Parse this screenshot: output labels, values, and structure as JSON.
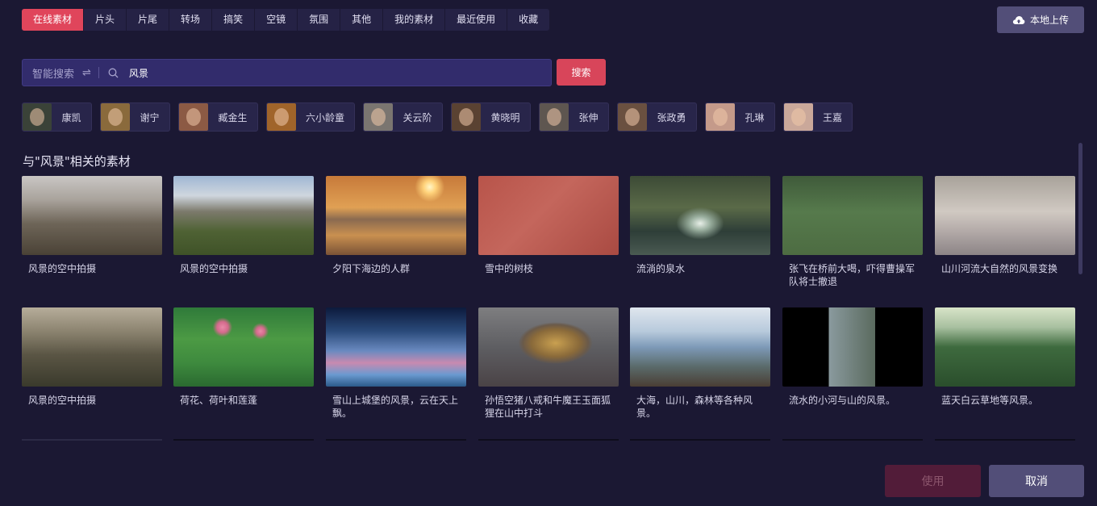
{
  "tabs": [
    "在线素材",
    "片头",
    "片尾",
    "转场",
    "搞笑",
    "空镜",
    "氛围",
    "其他",
    "我的素材",
    "最近使用",
    "收藏"
  ],
  "active_tab": "在线素材",
  "upload_label": "本地上传",
  "search": {
    "mode_label": "智能搜索",
    "swap_symbol": "⇌",
    "query": "风景",
    "button_label": "搜索"
  },
  "people": [
    {
      "name": "康凯",
      "icon": "face-portrait"
    },
    {
      "name": "谢宁",
      "icon": "face-portrait"
    },
    {
      "name": "臧金生",
      "icon": "face-portrait"
    },
    {
      "name": "六小龄童",
      "icon": "face-portrait"
    },
    {
      "name": "关云阶",
      "icon": "face-portrait"
    },
    {
      "name": "黄晓明",
      "icon": "face-portrait"
    },
    {
      "name": "张伸",
      "icon": "face-portrait"
    },
    {
      "name": "张政勇",
      "icon": "face-portrait"
    },
    {
      "name": "孔琳",
      "icon": "face-portrait"
    },
    {
      "name": "王嘉",
      "icon": "face-portrait"
    }
  ],
  "section_title": "与\"风景\"相关的素材",
  "materials": [
    {
      "caption": "风景的空中拍摄"
    },
    {
      "caption": "风景的空中拍摄"
    },
    {
      "caption": "夕阳下海边的人群"
    },
    {
      "caption": "雪中的树枝"
    },
    {
      "caption": "流淌的泉水"
    },
    {
      "caption": "张飞在桥前大喝，吓得曹操军队将士撤退"
    },
    {
      "caption": "山川河流大自然的风景变换"
    },
    {
      "caption": "风景的空中拍摄"
    },
    {
      "caption": "荷花、荷叶和莲蓬"
    },
    {
      "caption": "雪山上城堡的风景，云在天上飘。"
    },
    {
      "caption": "孙悟空猪八戒和牛魔王玉面狐狸在山中打斗"
    },
    {
      "caption": "大海，山川，森林等各种风景。"
    },
    {
      "caption": "流水的小河与山的风景。"
    },
    {
      "caption": "蓝天白云草地等风景。"
    }
  ],
  "footer": {
    "use_label": "使用",
    "cancel_label": "取消"
  },
  "colors": {
    "background": "#1b1833",
    "accent": "#e0455b",
    "search_bg": "#322c6c",
    "secondary_button": "#524e78"
  }
}
